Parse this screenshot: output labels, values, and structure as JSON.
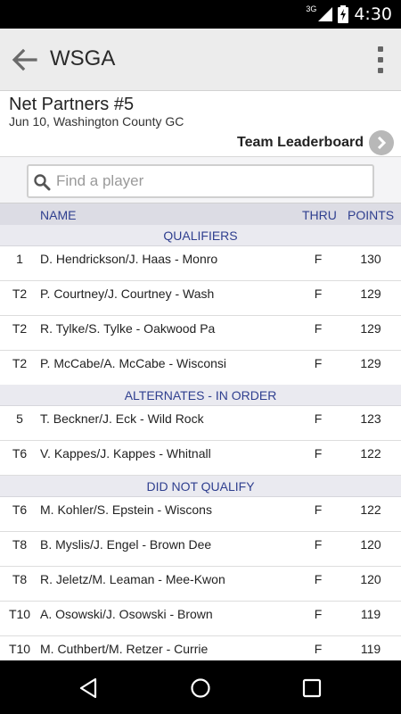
{
  "status_bar": {
    "network": "3G",
    "time": "4:30"
  },
  "app_bar": {
    "title": "WSGA"
  },
  "event": {
    "name": "Net Partners #5",
    "subtitle": "Jun 10, Washington County GC",
    "leaderboard_link": "Team Leaderboard"
  },
  "search": {
    "placeholder": "Find a player",
    "value": ""
  },
  "table": {
    "headers": {
      "name": "NAME",
      "thru": "THRU",
      "points": "POINTS"
    },
    "sections": [
      {
        "title": "QUALIFIERS",
        "rows": [
          {
            "pos": "1",
            "name": "D. Hendrickson/J. Haas - Monro",
            "thru": "F",
            "points": "130"
          },
          {
            "pos": "T2",
            "name": "P. Courtney/J. Courtney - Wash",
            "thru": "F",
            "points": "129"
          },
          {
            "pos": "T2",
            "name": "R. Tylke/S. Tylke - Oakwood Pa",
            "thru": "F",
            "points": "129"
          },
          {
            "pos": "T2",
            "name": "P. McCabe/A. McCabe - Wisconsi",
            "thru": "F",
            "points": "129"
          }
        ]
      },
      {
        "title": "ALTERNATES - IN ORDER",
        "rows": [
          {
            "pos": "5",
            "name": "T. Beckner/J. Eck - Wild Rock",
            "thru": "F",
            "points": "123"
          },
          {
            "pos": "T6",
            "name": "V. Kappes/J. Kappes - Whitnall",
            "thru": "F",
            "points": "122"
          }
        ]
      },
      {
        "title": "DID NOT QUALIFY",
        "rows": [
          {
            "pos": "T6",
            "name": "M. Kohler/S. Epstein - Wiscons",
            "thru": "F",
            "points": "122"
          },
          {
            "pos": "T8",
            "name": "B. Myslis/J. Engel - Brown Dee",
            "thru": "F",
            "points": "120"
          },
          {
            "pos": "T8",
            "name": "R. Jeletz/M. Leaman - Mee-Kwon",
            "thru": "F",
            "points": "120"
          },
          {
            "pos": "T10",
            "name": "A. Osowski/J. Osowski - Brown",
            "thru": "F",
            "points": "119"
          },
          {
            "pos": "T10",
            "name": "M. Cuthbert/M. Retzer - Currie",
            "thru": "F",
            "points": "119"
          }
        ]
      }
    ]
  },
  "colors": {
    "accent_text": "#2f3f8f",
    "app_bar_bg": "#ececec",
    "header_bg": "#dcdce4",
    "section_bg": "#eaeaf0"
  },
  "icons": {
    "back": "arrow-left-icon",
    "menu": "overflow-menu-icon",
    "link": "chevron-right-icon",
    "search": "search-icon",
    "nav": [
      "back-triangle-icon",
      "home-circle-icon",
      "recents-square-icon"
    ]
  }
}
